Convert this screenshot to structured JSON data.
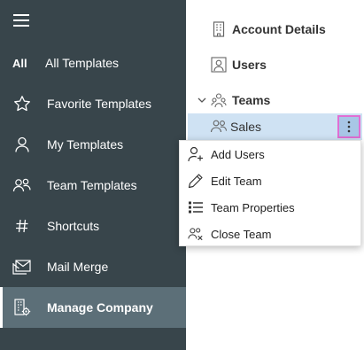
{
  "sidebar": {
    "all_badge": "All",
    "items": [
      {
        "label": "All Templates",
        "icon": "all-badge"
      },
      {
        "label": "Favorite Templates",
        "icon": "star-icon"
      },
      {
        "label": "My Templates",
        "icon": "person-icon"
      },
      {
        "label": "Team Templates",
        "icon": "people-icon"
      },
      {
        "label": "Shortcuts",
        "icon": "hash-icon"
      },
      {
        "label": "Mail Merge",
        "icon": "mail-merge-icon"
      },
      {
        "label": "Manage Company",
        "icon": "company-gear-icon"
      }
    ],
    "active_item": "Manage Company"
  },
  "tree": {
    "account_details": "Account Details",
    "users": "Users",
    "teams": "Teams",
    "sales": "Sales"
  },
  "context_menu": {
    "items": [
      {
        "label": "Add Users",
        "icon": "person-add-icon"
      },
      {
        "label": "Edit Team",
        "icon": "pencil-icon"
      },
      {
        "label": "Team Properties",
        "icon": "list-icon"
      },
      {
        "label": "Close Team",
        "icon": "people-close-icon"
      }
    ]
  },
  "colors": {
    "sidebar_bg": "#38454b",
    "active_bg": "#5c6f78",
    "selected_row": "#cfe2f3",
    "more_button_border": "#e06fd4"
  }
}
